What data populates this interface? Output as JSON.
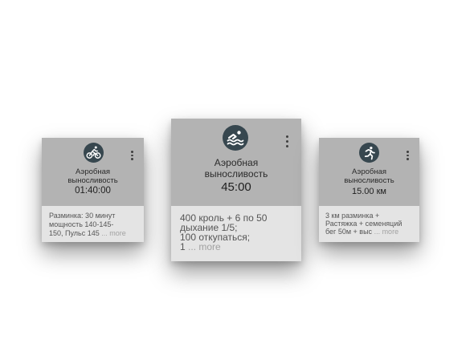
{
  "cards": [
    {
      "icon": "bicycle-icon",
      "title": "Аэробная\nвыносливость",
      "value": "01:40:00",
      "description": "Разминка: 30 минут\nмощность 140-145-\n150, Пульс 145",
      "more": " ... more"
    },
    {
      "icon": "swimming-icon",
      "title": "Аэробная\nвыносливость",
      "value": "45:00",
      "description": "400 кроль + 6 по 50\nдыхание 1/5;\n100 откупаться;\n1",
      "more": " ... more"
    },
    {
      "icon": "running-icon",
      "title": "Аэробная\nвыносливость",
      "value": "15.00 км",
      "description": "3 км разминка +\nРастяжка + семеняций\nбег 50м + выс",
      "more": " ... more"
    }
  ],
  "colors": {
    "card_top": "#b3b3b3",
    "card_bottom": "#e4e4e4",
    "icon_circle": "#37474f",
    "more_text": "#a2a2a2"
  }
}
